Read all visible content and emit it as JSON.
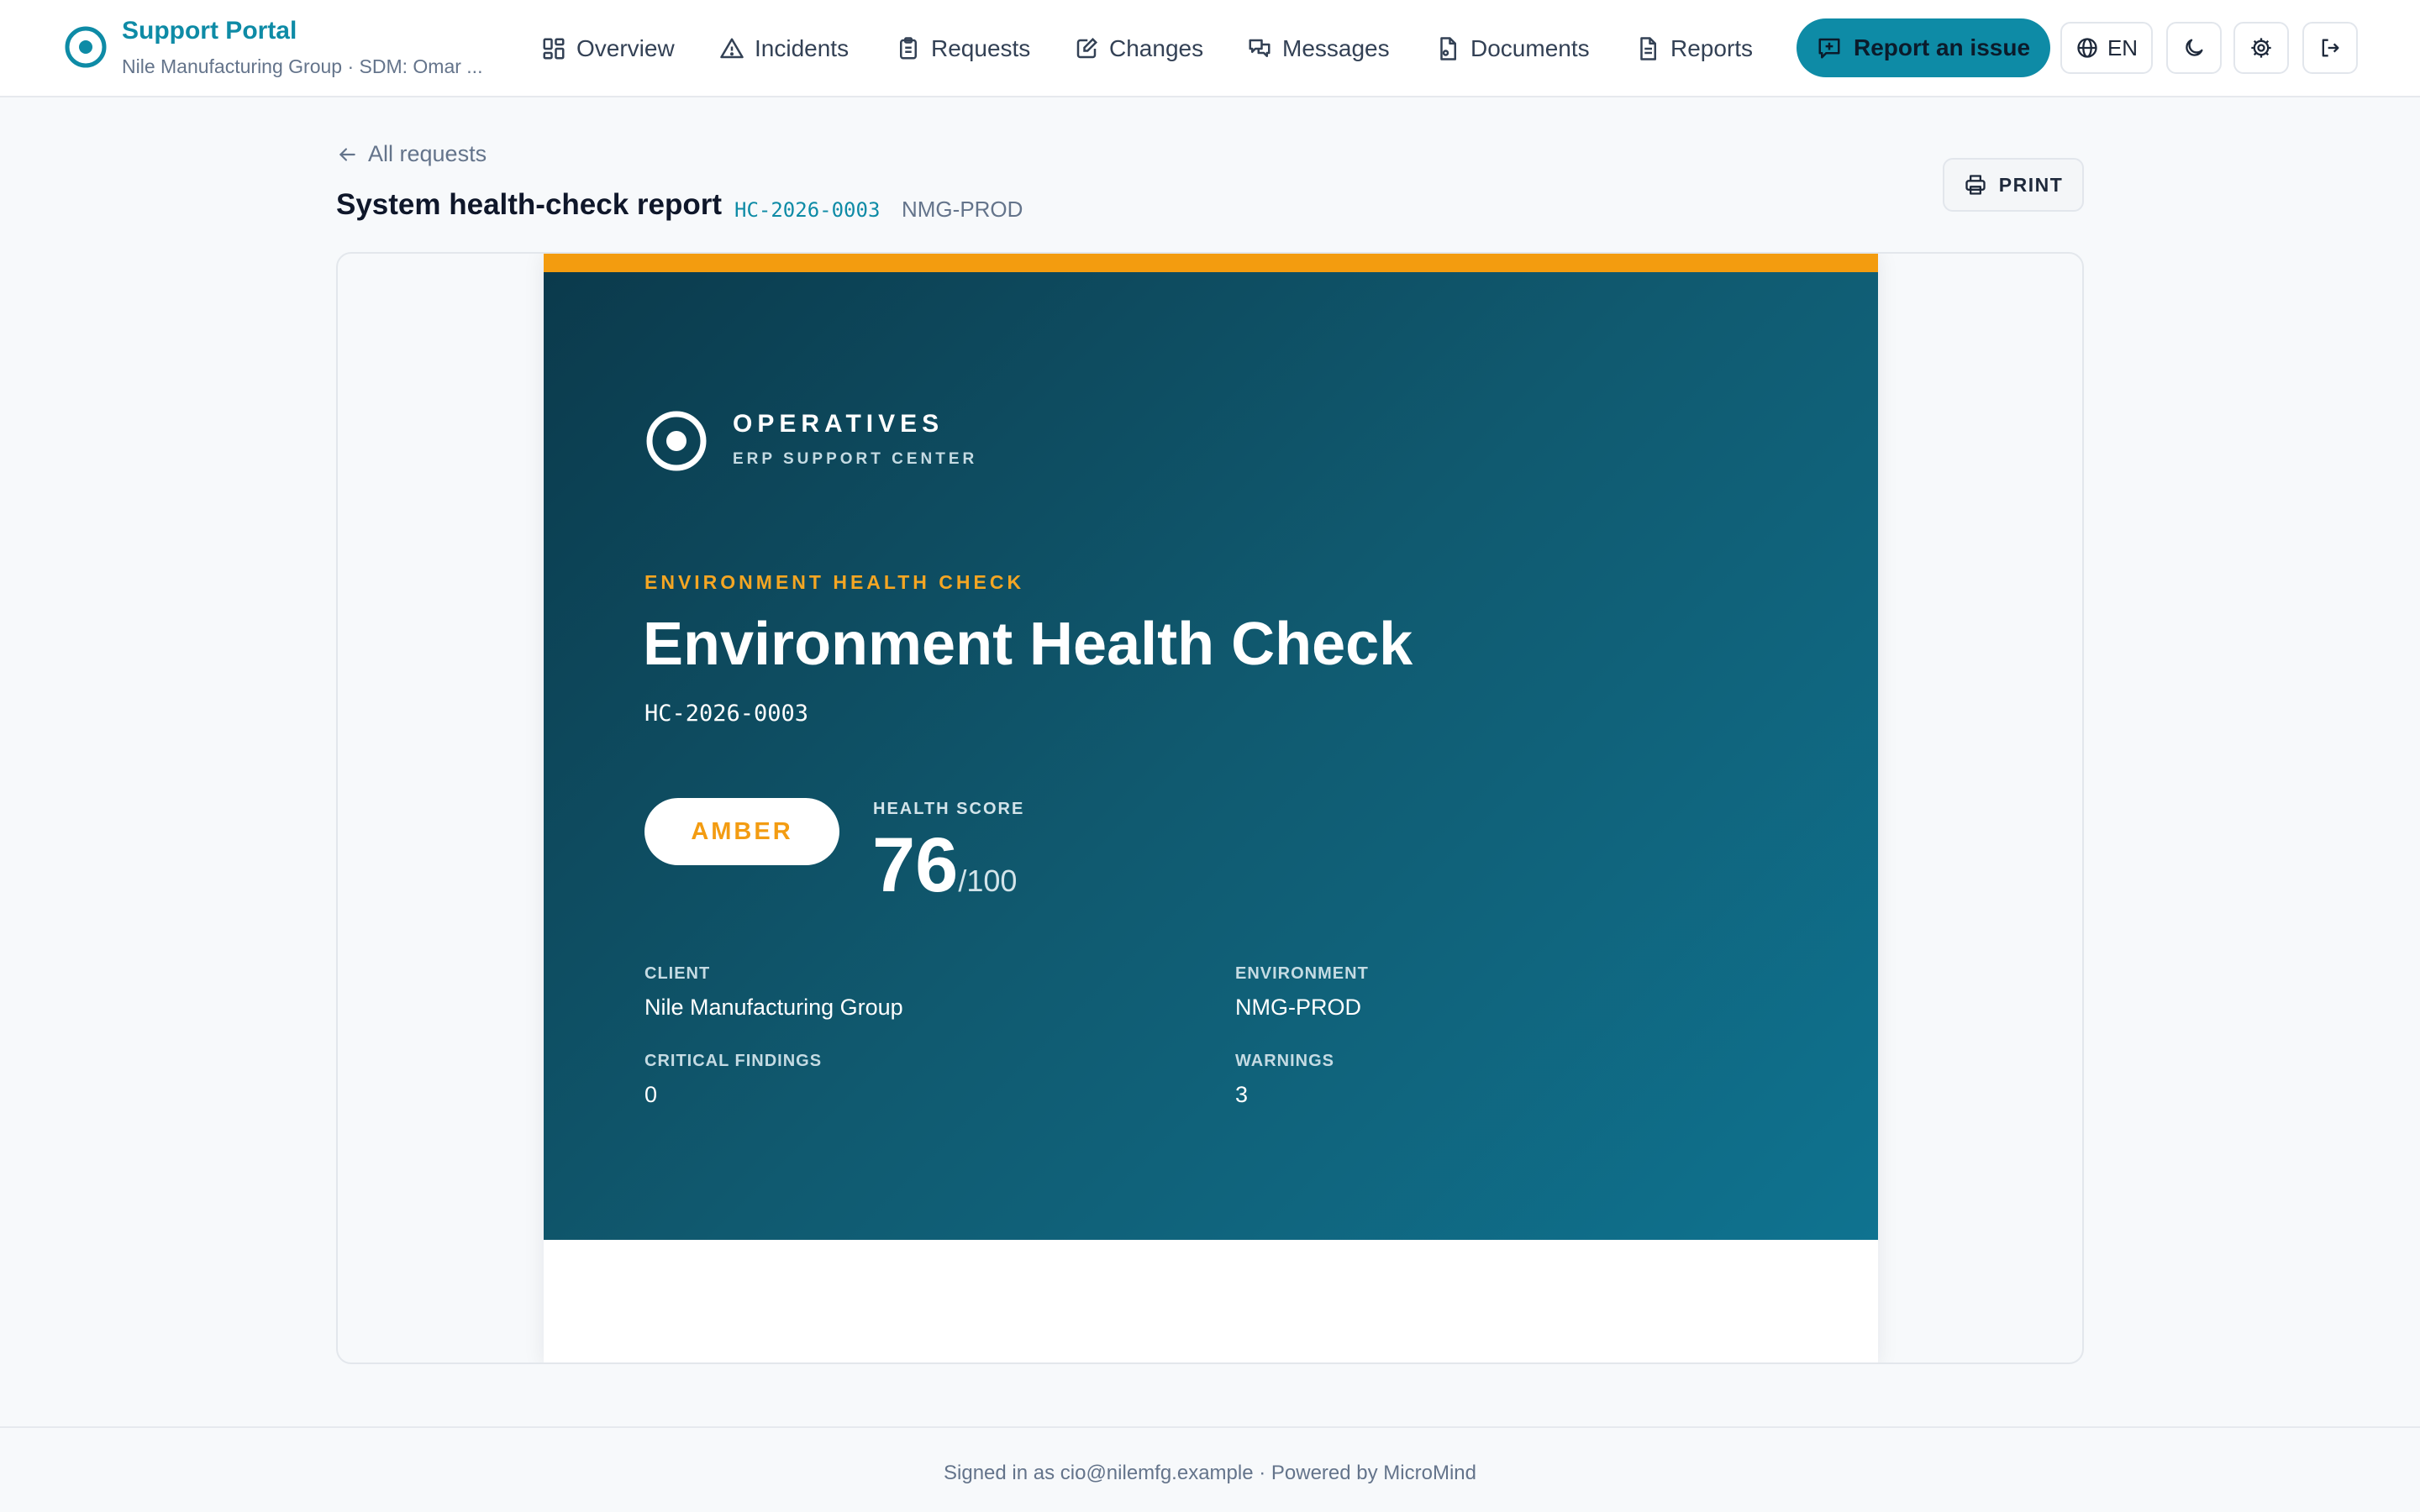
{
  "header": {
    "brand_title": "Support Portal",
    "brand_subtitle": "Nile Manufacturing Group · SDM: Omar ...",
    "nav": {
      "overview": "Overview",
      "incidents": "Incidents",
      "requests": "Requests",
      "changes": "Changes",
      "messages": "Messages",
      "documents": "Documents",
      "reports": "Reports"
    },
    "report_button": "Report an issue",
    "language": "EN"
  },
  "page": {
    "back_label": "All requests",
    "title": "System health-check report",
    "code": "HC-2026-0003",
    "environment": "NMG-PROD",
    "print_label": "PRINT"
  },
  "report": {
    "brand_name": "OPERATIVES",
    "brand_tagline": "ERP SUPPORT CENTER",
    "eyebrow": "ENVIRONMENT HEALTH CHECK",
    "title": "Environment Health Check",
    "code": "HC-2026-0003",
    "status": "AMBER",
    "score_label": "HEALTH SCORE",
    "score": "76",
    "score_max": "/100",
    "meta": {
      "client_label": "CLIENT",
      "client_value": "Nile Manufacturing Group",
      "environment_label": "ENVIRONMENT",
      "environment_value": "NMG-PROD",
      "critical_label": "CRITICAL FINDINGS",
      "critical_value": "0",
      "warnings_label": "WARNINGS",
      "warnings_value": "3"
    }
  },
  "footer": {
    "text": "Signed in as cio@nilemfg.example · Powered by MicroMind"
  },
  "colors": {
    "brand": "#0e8ba6",
    "accent_amber": "#f39c0f",
    "cover_dark": "#0b3a4c",
    "cover_light": "#0f7390"
  }
}
